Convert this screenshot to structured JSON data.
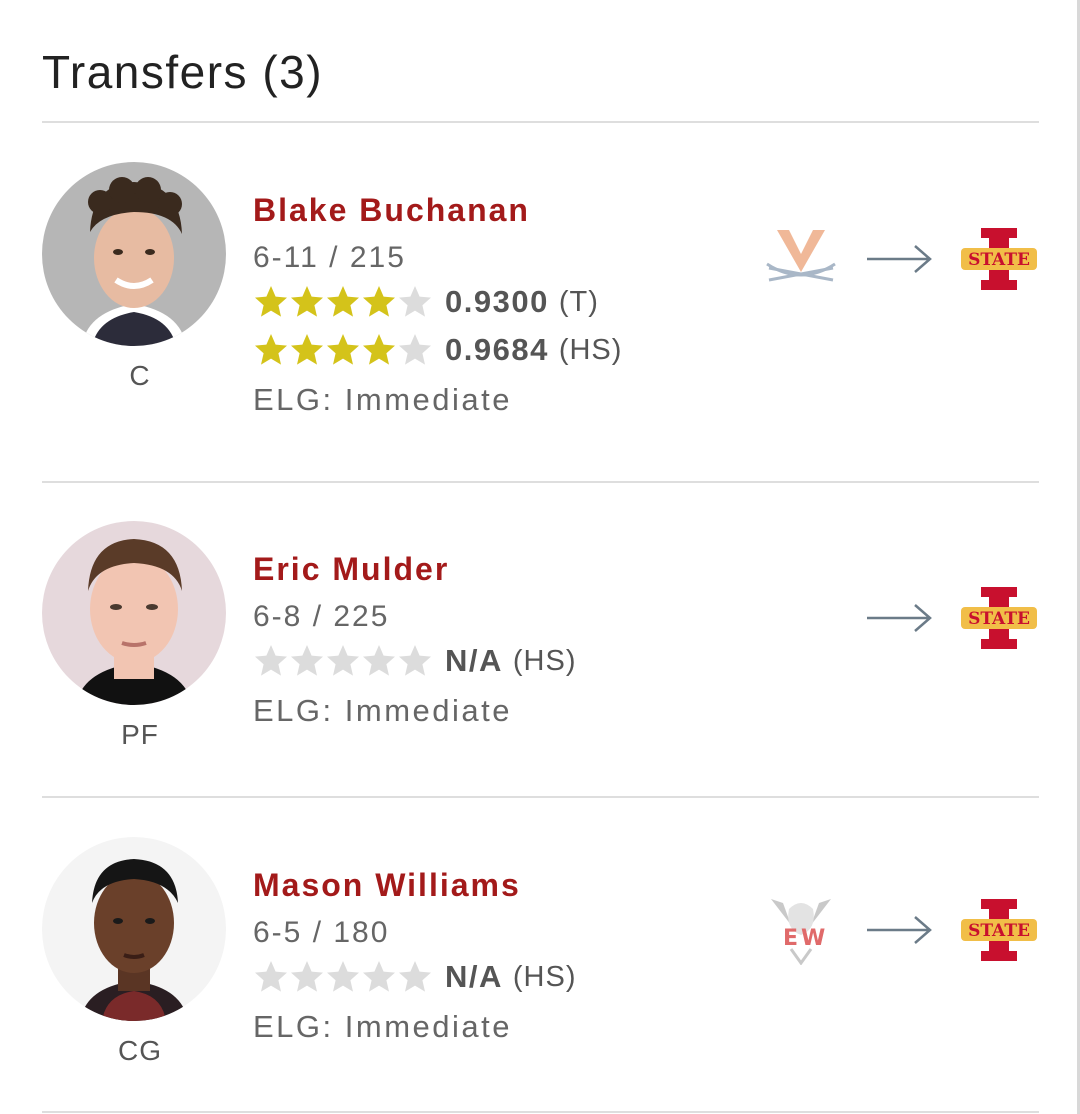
{
  "section": {
    "title": "Transfers (3)"
  },
  "players": [
    {
      "name": "Blake Buchanan",
      "height_weight": "6-11 / 215",
      "position": "C",
      "ratings": [
        {
          "stars": 4,
          "score": "0.9300",
          "type": "(T)"
        },
        {
          "stars": 4,
          "score": "0.9684",
          "type": "(HS)"
        }
      ],
      "eligibility": "ELG: Immediate",
      "from_logo": "virginia-logo",
      "to_logo": "iowa-state-logo"
    },
    {
      "name": "Eric Mulder",
      "height_weight": "6-8 / 225",
      "position": "PF",
      "ratings": [
        {
          "stars": 0,
          "score": "N/A",
          "type": "(HS)"
        }
      ],
      "eligibility": "ELG: Immediate",
      "from_logo": "",
      "to_logo": "iowa-state-logo"
    },
    {
      "name": "Mason Williams",
      "height_weight": "6-5 / 180",
      "position": "CG",
      "ratings": [
        {
          "stars": 0,
          "score": "N/A",
          "type": "(HS)"
        }
      ],
      "eligibility": "ELG: Immediate",
      "from_logo": "eastern-washington-logo",
      "to_logo": "iowa-state-logo"
    }
  ],
  "colors": {
    "name": "#a31a1a",
    "star_on": "#d4c31a",
    "star_off": "#dcdcdc",
    "divider": "#dedede",
    "iowa_state_red": "#c8102e",
    "iowa_state_gold": "#f1be48"
  }
}
